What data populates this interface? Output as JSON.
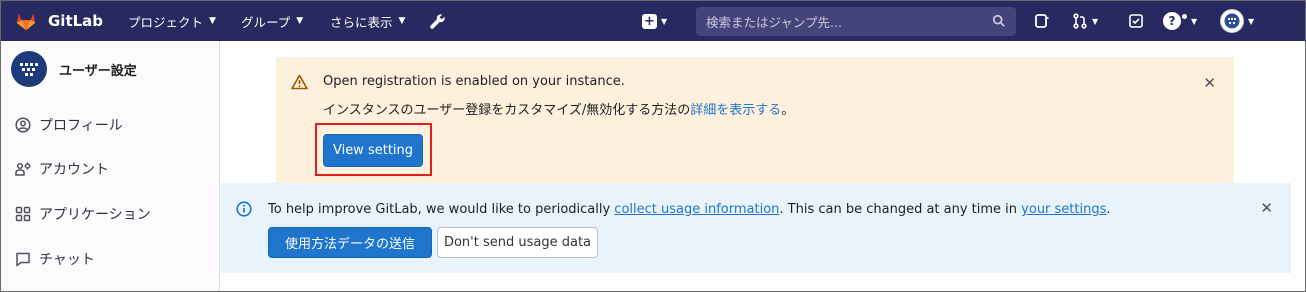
{
  "navbar": {
    "logo_text": "GitLab",
    "menu": [
      {
        "label": "プロジェクト"
      },
      {
        "label": "グループ"
      },
      {
        "label": "さらに表示"
      }
    ],
    "search_placeholder": "検索またはジャンプ先..."
  },
  "sidebar": {
    "title": "ユーザー設定",
    "items": [
      {
        "label": "プロフィール",
        "icon": "profile-icon"
      },
      {
        "label": "アカウント",
        "icon": "account-icon"
      },
      {
        "label": "アプリケーション",
        "icon": "applications-icon"
      },
      {
        "label": "チャット",
        "icon": "chat-icon"
      }
    ]
  },
  "warning_alert": {
    "title": "Open registration is enabled on your instance.",
    "body_prefix": "インスタンスのユーザー登録をカスタマイズ/無効化する方法の",
    "body_link": "詳細を表示する",
    "body_suffix": "。",
    "button_label": "View setting"
  },
  "info_alert": {
    "text_prefix": "To help improve GitLab, we would like to periodically ",
    "link1": "collect usage information",
    "text_middle": ". This can be changed at any time in ",
    "link2": "your settings",
    "text_suffix": ".",
    "primary_button": "使用方法データの送信",
    "secondary_button": "Don't send usage data"
  },
  "colors": {
    "navbar_bg": "#292961",
    "primary": "#1f75cb",
    "warning_bg": "#fdf1dd",
    "info_bg": "#e9f3fc",
    "highlight": "#e01f1f"
  }
}
